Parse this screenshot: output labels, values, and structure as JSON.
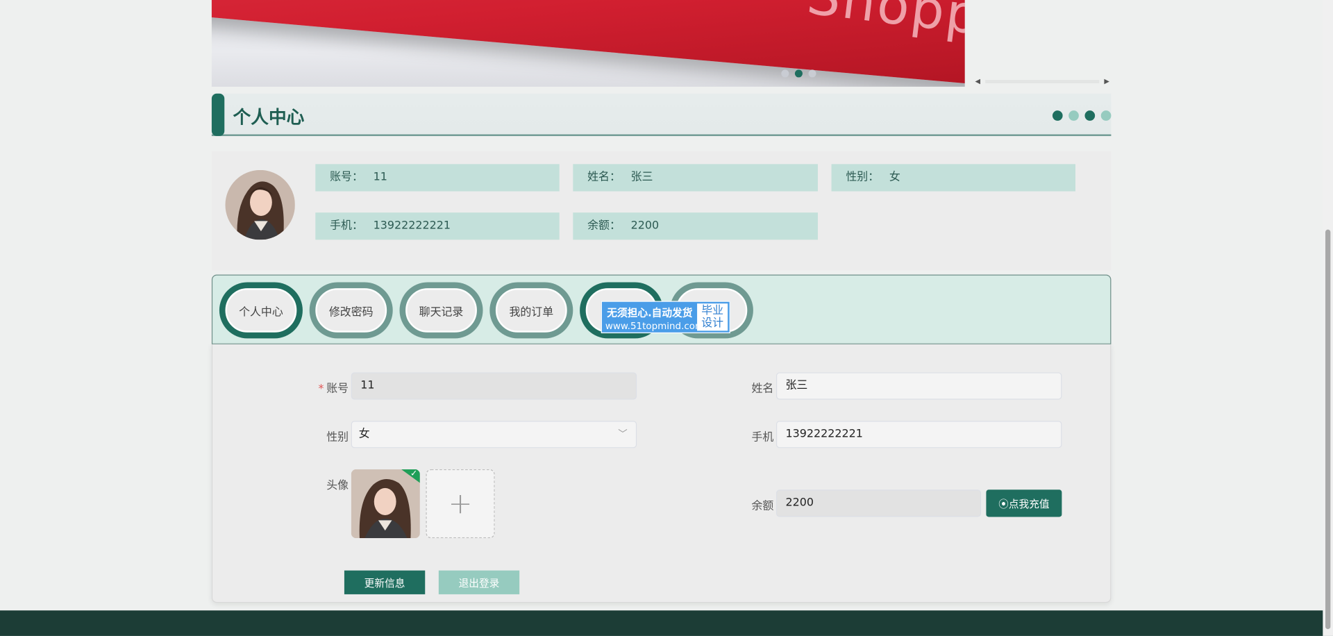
{
  "banner": {
    "image_text": "Shopping",
    "carousel_dots": 3,
    "active_dot": 1
  },
  "section": {
    "title": "个人中心",
    "decor_colors": [
      "#1f6e5f",
      "#96cbbf",
      "#1f6e5f",
      "#96cbbf"
    ]
  },
  "profile": {
    "account_label": "账号：",
    "account_value": "11",
    "name_label": "姓名：",
    "name_value": "张三",
    "gender_label": "性别：",
    "gender_value": "女",
    "phone_label": "手机：",
    "phone_value": "13922222221",
    "balance_label": "余额：",
    "balance_value": "2200"
  },
  "tabs": [
    {
      "label": "个人中心",
      "active": true
    },
    {
      "label": "修改密码",
      "active": false
    },
    {
      "label": "聊天记录",
      "active": false
    },
    {
      "label": "我的订单",
      "active": false
    },
    {
      "label": "",
      "active": true
    },
    {
      "label": "",
      "active": false
    }
  ],
  "ad": {
    "line1": "无须担心.自动发货",
    "line2": "www.51topmind.com",
    "badge_line1": "毕业",
    "badge_line2": "设计"
  },
  "form": {
    "account_label": "账号",
    "account_required_mark": "*",
    "account_value": "11",
    "name_label": "姓名",
    "name_value": "张三",
    "gender_label": "性别",
    "gender_value": "女",
    "phone_label": "手机",
    "phone_value": "13922222221",
    "avatar_label": "头像",
    "upload_add_symbol": "+",
    "balance_label": "余额",
    "balance_value": "2200",
    "recharge_label": "⦿点我充值",
    "update_label": "更新信息",
    "logout_label": "退出登录"
  },
  "colors": {
    "primary": "#1f6e5f",
    "light": "#96cbbf",
    "info_cell": "#c3e0da",
    "footer": "#1c3d36"
  },
  "icons": {
    "dropdown": "chevron-down-icon",
    "upload_add": "plus-icon",
    "upload_done": "check-icon",
    "recharge": "radio-circle-icon"
  }
}
